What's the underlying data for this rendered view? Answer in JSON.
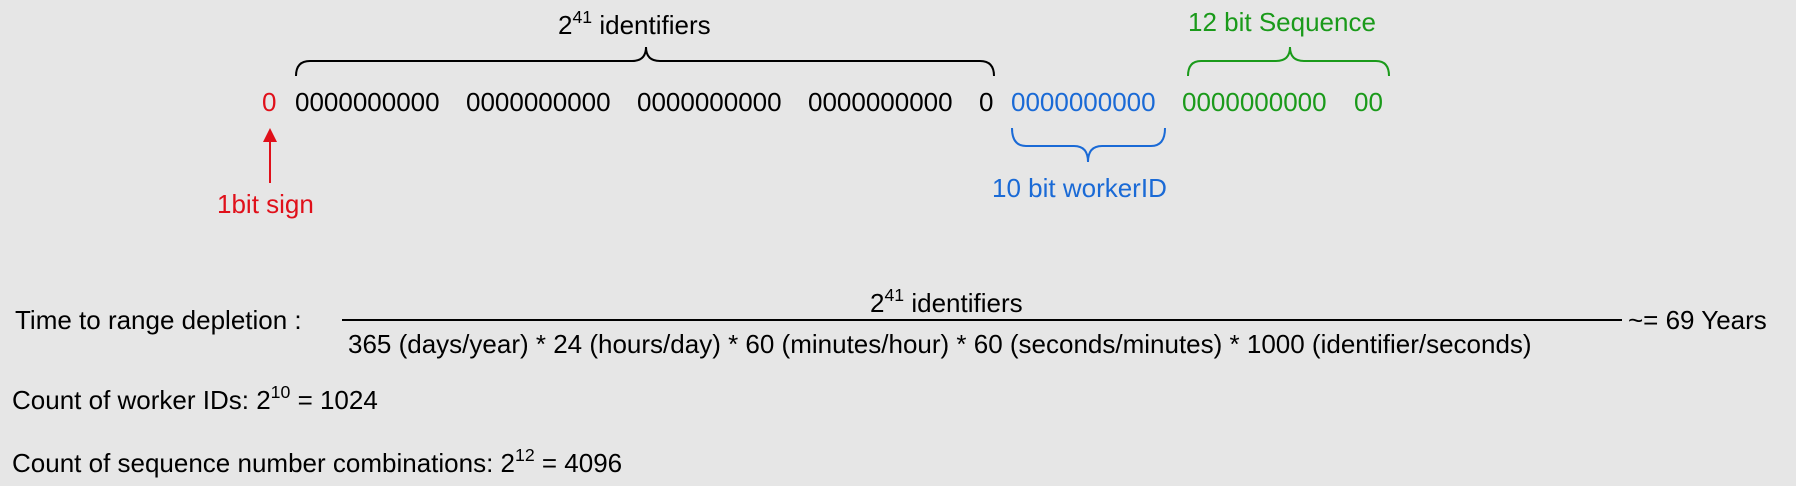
{
  "colors": {
    "sign": "#e0101a",
    "timestamp": "#000000",
    "worker": "#1a6ad6",
    "sequence": "#1a9a1a",
    "background": "#e6e6e6"
  },
  "bit_layout": {
    "sign_bit": "0",
    "timestamp_groups": [
      "0000000000",
      "0000000000",
      "0000000000",
      "0000000000",
      "0"
    ],
    "worker_bits": "0000000000",
    "sequence_groups": [
      "0000000000",
      "00"
    ]
  },
  "labels": {
    "timestamp_base": "2",
    "timestamp_exp": "41",
    "timestamp_suffix": " identifiers",
    "sequence_label": "12 bit Sequence",
    "worker_label": "10 bit workerID",
    "sign_label": "1bit sign"
  },
  "formula": {
    "lhs": "Time to range depletion :",
    "numerator_base": "2",
    "numerator_exp": "41",
    "numerator_suffix": " identifiers",
    "denominator": "365 (days/year) * 24 (hours/day) * 60 (minutes/hour) * 60 (seconds/minutes) * 1000 (identifier/seconds)",
    "result": "~= 69 Years"
  },
  "worker_count": {
    "label": "Count of worker IDs: ",
    "base": "2",
    "exp": "10",
    "result": " = 1024"
  },
  "sequence_count": {
    "label": "Count of sequence number combinations: ",
    "base": "2",
    "exp": "12",
    "result": " = 4096"
  }
}
